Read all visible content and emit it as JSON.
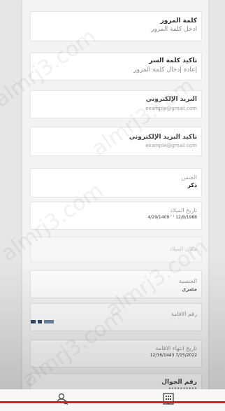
{
  "watermark": "almrj3.com",
  "fields": {
    "password": {
      "label": "كلمة المرور",
      "placeholder": "أدخل كلمة المرور"
    },
    "confirm_password": {
      "label": "تأكيد كلمة السر",
      "placeholder": "إعادة إدخال كلمة المرور"
    },
    "email": {
      "label": "البريد الإلكتروني",
      "placeholder": "example@gmail.com"
    },
    "confirm_email": {
      "label": "تأكيد البريد الإلكتروني",
      "placeholder": "example@gmail.com"
    },
    "gender": {
      "label": "الجنس",
      "value": "ذكر"
    },
    "birth_date": {
      "label": "تاريخ الميلاد",
      "value": "12/8/1988 ' ' 4/29/1409"
    },
    "disabled_field": {
      "label": "مكان الميلاد"
    },
    "nationality": {
      "label": "الجنسية",
      "value": "مصري"
    },
    "residence_number": {
      "label": "رقم الاقامة"
    },
    "residence_expiry": {
      "label": "تاريخ انتهاء الاقامة",
      "value": "7/15/2022 12/16/1443"
    },
    "mobile": {
      "label": "رقم الجوال",
      "value": "••••••••••"
    }
  },
  "colors": {
    "accent_line": "#e21b1b",
    "masked_block": "#2f4f6f"
  },
  "icons": {
    "left_nav": "user-search-icon",
    "right_nav": "building-icon"
  }
}
